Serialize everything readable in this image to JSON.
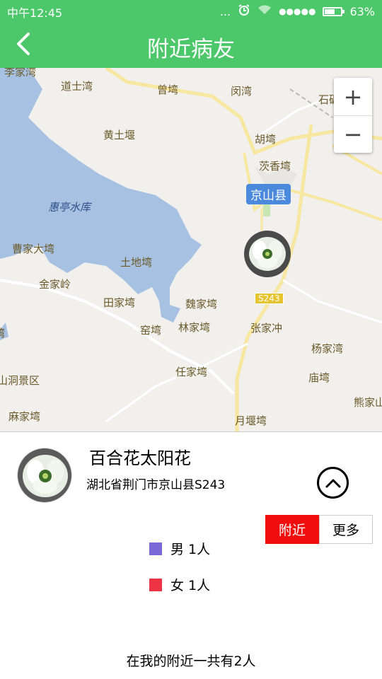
{
  "status": {
    "time": "中午12:45",
    "dots": "...",
    "signal": "●●●●●",
    "battery": "63%",
    "battery_level": 0.63
  },
  "header": {
    "title": "附近病友"
  },
  "map": {
    "zoom_in": "+",
    "zoom_out": "−",
    "county_label": "京山县",
    "road_label": "S243",
    "places": [
      "李家湾",
      "道士湾",
      "曾塆",
      "闵湾",
      "石碾头湾",
      "胡塆",
      "黄土堰",
      "茨香塆",
      "惠亭水库",
      "曹家大塆",
      "土地塆",
      "金家岭",
      "田家塆",
      "魏家塆",
      "窑塆",
      "林家塆",
      "张家冲",
      "塆",
      "杨家湾",
      "庙塆",
      "任家塆",
      "熊家山",
      "山洞景区",
      "麻家塆",
      "月堰塆"
    ]
  },
  "user": {
    "name": "百合花太阳花",
    "address": "湖北省荆门市京山县S243"
  },
  "tabs": {
    "nearby": "附近",
    "more": "更多"
  },
  "legend": [
    {
      "label": "男 1人",
      "color": "#7b68d8"
    },
    {
      "label": "女 1人",
      "color": "#ee3344"
    }
  ],
  "summary": "在我的附近一共有2人",
  "colors": {
    "brand": "#4cc76a",
    "active_tab": "#f20d0d"
  }
}
